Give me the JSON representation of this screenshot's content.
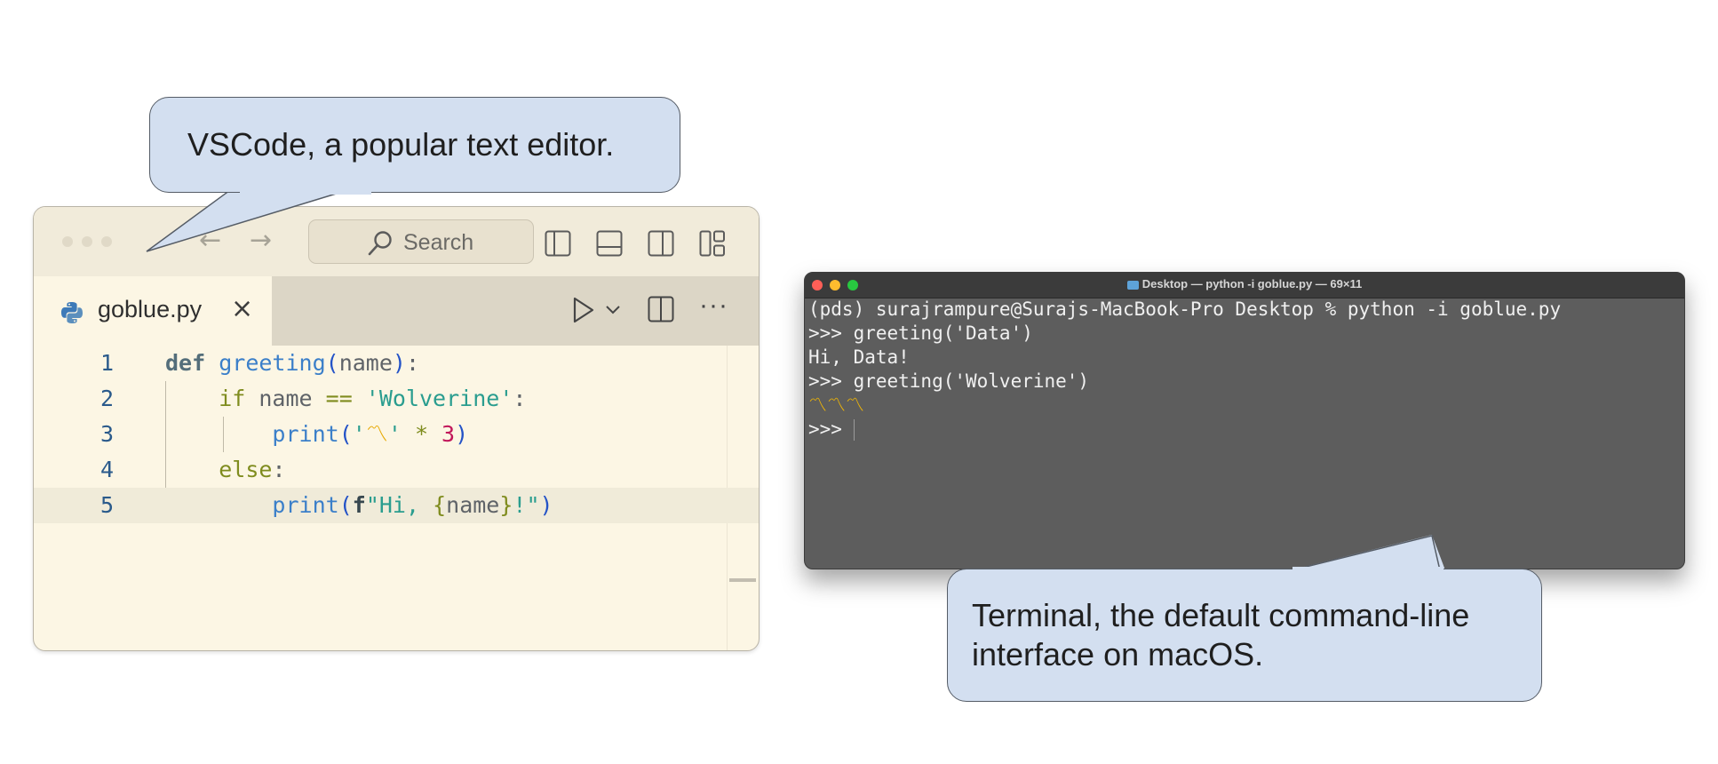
{
  "vscode": {
    "callout_text": "VSCode, a popular text editor.",
    "search_label": "Search",
    "tab_label": "goblue.py",
    "tab_close": "×",
    "nav_back": "←",
    "nav_forward": "→",
    "more_label": "···",
    "line_numbers": [
      "1",
      "2",
      "3",
      "4",
      "5"
    ],
    "code": {
      "l1": {
        "def": "def",
        "fn": "greeting",
        "open": "(",
        "param": "name",
        "close": ")",
        "colon": ":"
      },
      "l2": {
        "if": "if",
        "name": " name ",
        "op": "==",
        "str": " 'Wolverine'",
        "colon": ":"
      },
      "l3": {
        "fn": "print",
        "open": "(",
        "str_open": "'",
        "emoji": "〽",
        "str_close": "'",
        "op": " * ",
        "num": "3",
        "close": ")"
      },
      "l4": {
        "else": "else",
        "colon": ":"
      },
      "l5": {
        "fn": "print",
        "open": "(",
        "f": "f",
        "str1": "\"Hi, ",
        "brace_open": "{",
        "var": "name",
        "brace_close": "}",
        "str2": "!\"",
        "close": ")"
      }
    }
  },
  "terminal": {
    "title": "Desktop — python -i goblue.py — 69×11",
    "lines": [
      "(pds) surajrampure@Surajs-MacBook-Pro Desktop % python -i goblue.py",
      ">>> greeting('Data')",
      "Hi, Data!",
      ">>> greeting('Wolverine')"
    ],
    "emoji_line": "〽〽〽",
    "prompt": ">>> ",
    "callout_text_1": "Terminal, the default command-line",
    "callout_text_2": "interface on macOS."
  },
  "colors": {
    "callout_fill": "#d3dff0",
    "editor_bg": "#fcf6e4",
    "terminal_bg": "#5d5d5d"
  }
}
